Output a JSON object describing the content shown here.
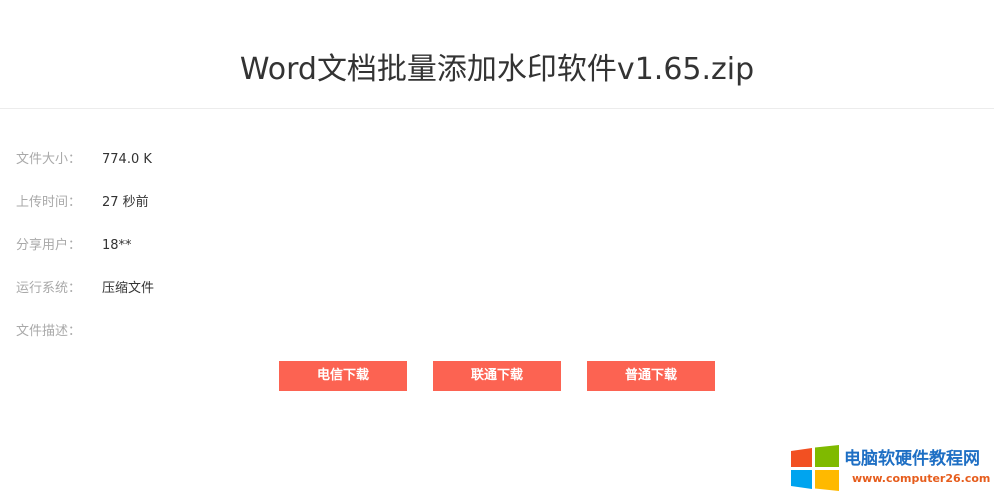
{
  "file": {
    "title": "Word文档批量添加水印软件v1.65.zip"
  },
  "info": {
    "size_label": "文件大小：",
    "size_value": "774.0 K",
    "time_label": "上传时间：",
    "time_value": "27 秒前",
    "user_label": "分享用户：",
    "user_value": "18**",
    "os_label": "运行系统：",
    "os_value": "压缩文件",
    "desc_label": "文件描述：",
    "desc_value": ""
  },
  "buttons": {
    "telecom": "电信下载",
    "unicom": "联通下载",
    "normal": "普通下载"
  },
  "colors": {
    "button": "#fc6352",
    "label": "#a9a9a9",
    "text": "#333333"
  },
  "watermark": {
    "title": "电脑软硬件教程网",
    "url": "www.computer26.com",
    "icon": "windows-logo-icon"
  }
}
